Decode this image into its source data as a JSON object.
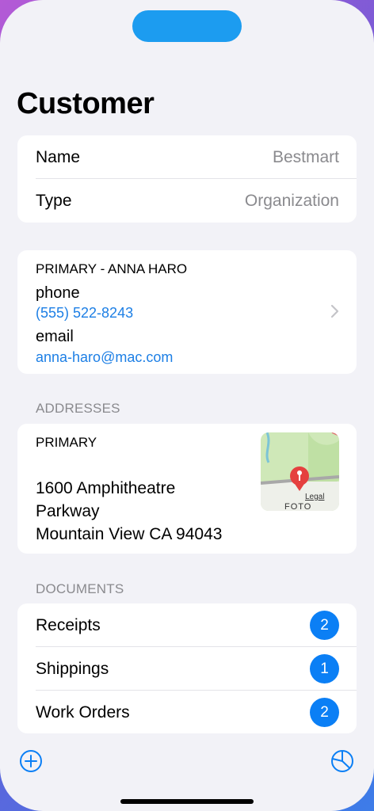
{
  "header": {
    "title": "Customer"
  },
  "details": {
    "rows": [
      {
        "label": "Name",
        "value": "Bestmart"
      },
      {
        "label": "Type",
        "value": "Organization"
      }
    ]
  },
  "contact": {
    "heading": "PRIMARY - ANNA HARO",
    "phone_label": "phone",
    "phone_value": "(555) 522-8243",
    "email_label": "email",
    "email_value": "anna-haro@mac.com",
    "chevron_icon": "chevron-right-icon"
  },
  "addresses": {
    "section_label": "ADDRESSES",
    "heading": "PRIMARY",
    "line1": "1600 Amphitheatre",
    "line2": "Parkway",
    "line3": "Mountain View CA 94043",
    "map_legal": "Legal",
    "map_text": "FOTO"
  },
  "documents": {
    "section_label": "DOCUMENTS",
    "items": [
      {
        "label": "Receipts",
        "count": "2"
      },
      {
        "label": "Shippings",
        "count": "1"
      },
      {
        "label": "Work Orders",
        "count": "2"
      }
    ]
  },
  "toolbar": {
    "left_icon": "plus-circle-icon",
    "right_icon": "pie-chart-icon"
  },
  "colors": {
    "accent": "#0b7ff5",
    "background": "#f2f2f7",
    "secondary_text": "#8a8a8e",
    "island": "#1c9cf0"
  }
}
